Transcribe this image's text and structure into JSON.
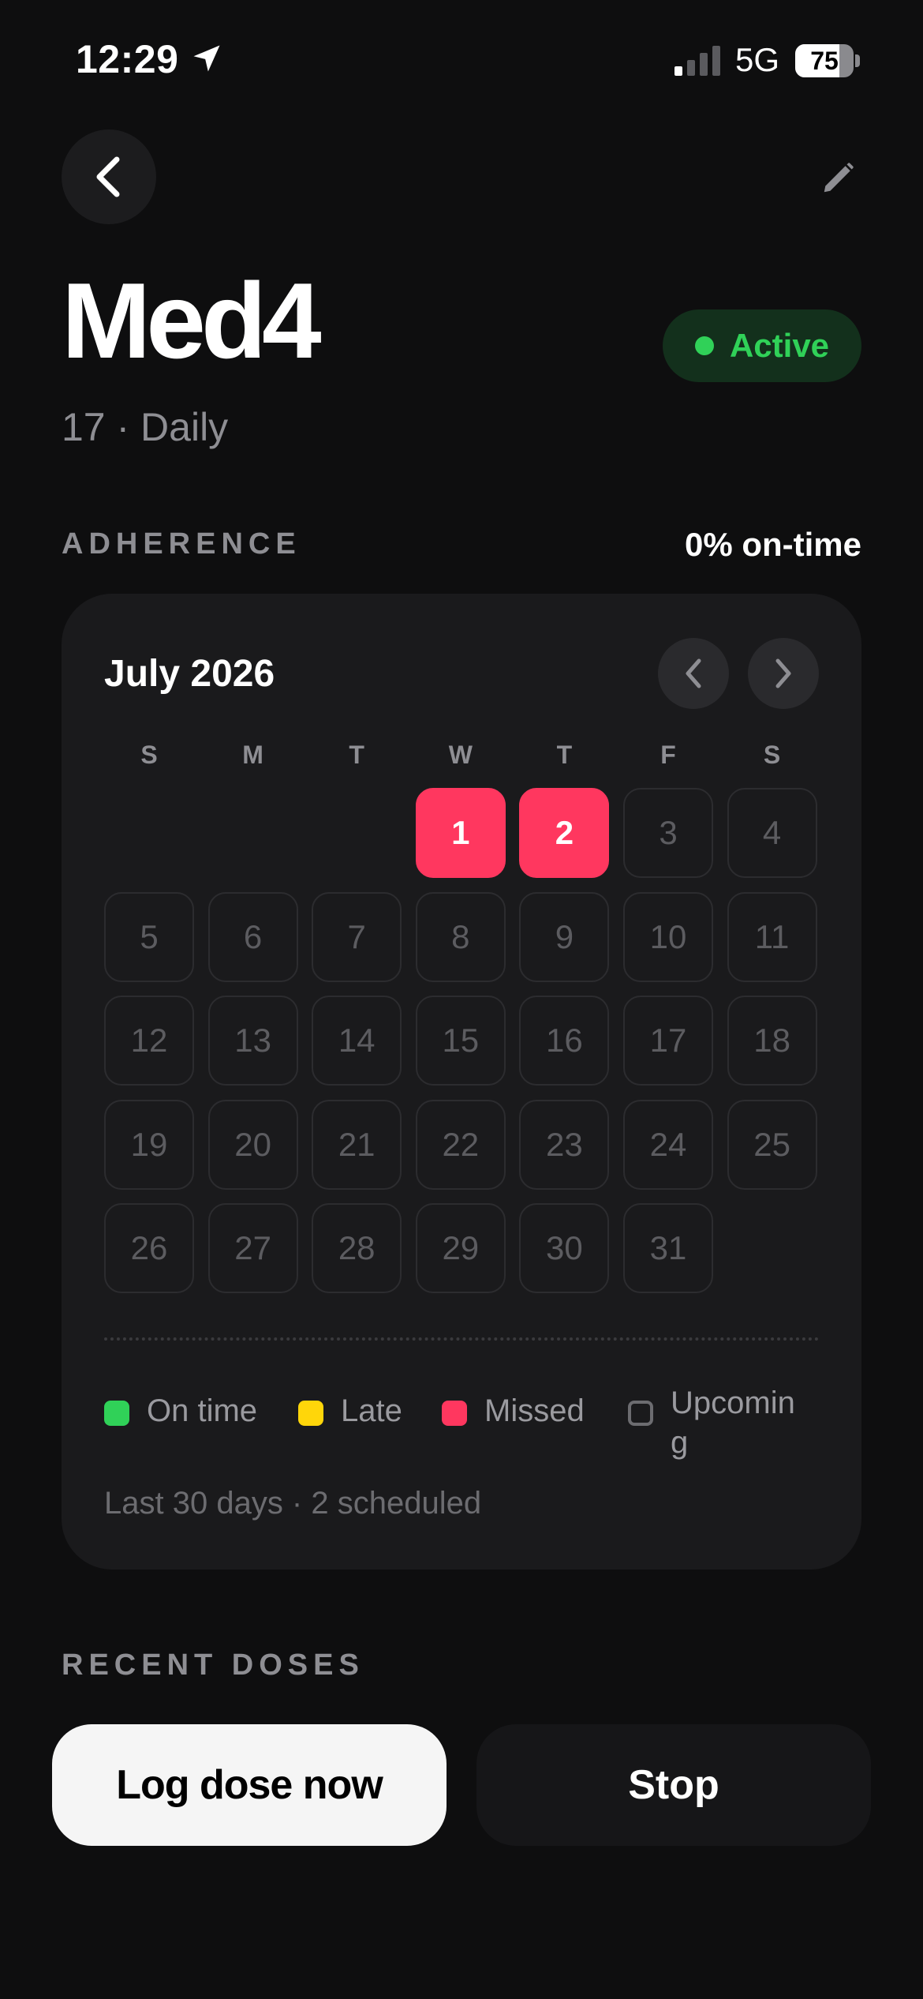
{
  "status_bar": {
    "time": "12:29",
    "network": "5G",
    "battery_level": 75,
    "battery_label": "75",
    "signal_bars_active": 1,
    "icons": [
      "location-arrow-icon",
      "signal-icon",
      "battery-icon"
    ]
  },
  "nav": {
    "back_icon": "chevron-left-icon",
    "edit_icon": "pencil-icon"
  },
  "header": {
    "title": "Med4",
    "subtitle": "17 · Daily",
    "status": "Active",
    "status_color": "#30d158"
  },
  "adherence": {
    "section_label": "ADHERENCE",
    "summary": "0% on-time",
    "calendar": {
      "month_label": "July 2026",
      "prev_icon": "chevron-left-icon",
      "next_icon": "chevron-right-icon",
      "weekdays": [
        "S",
        "M",
        "T",
        "W",
        "T",
        "F",
        "S"
      ],
      "first_weekday_index": 3,
      "days_in_month": 31,
      "missed_days": [
        1,
        2
      ],
      "on_time_days": [],
      "late_days": []
    },
    "legend": [
      {
        "label": "On time",
        "color": "#30d158",
        "style": "filled"
      },
      {
        "label": "Late",
        "color": "#ffd60a",
        "style": "filled"
      },
      {
        "label": "Missed",
        "color": "#ff375f",
        "style": "filled"
      },
      {
        "label": "Upcomin g",
        "color": "#6c6c70",
        "style": "outline"
      }
    ],
    "footnote": "Last 30 days · 2 scheduled"
  },
  "recent_doses": {
    "section_label": "RECENT DOSES"
  },
  "actions": {
    "log_label": "Log dose now",
    "stop_label": "Stop"
  }
}
